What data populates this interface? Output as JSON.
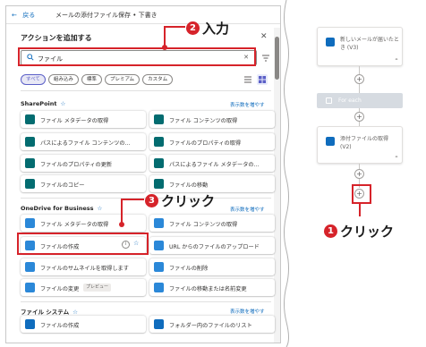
{
  "topbar": {
    "back_label": "戻る",
    "breadcrumb": "メールの添付ファイル保存 • 下書き"
  },
  "panel": {
    "title": "アクションを追加する"
  },
  "search": {
    "value": "ファイル"
  },
  "chips": [
    "すべて",
    "組み込み",
    "標準",
    "プレミアム",
    "カスタム"
  ],
  "sections": [
    {
      "name": "SharePoint",
      "see_more": "表示数を増やす",
      "actions": [
        "ファイル メタデータの取得",
        "ファイル コンテンツの取得",
        "パスによるファイル コンテンツの...",
        "ファイルのプロパティの取得",
        "ファイルのプロパティの更新",
        "パスによるファイル メタデータの...",
        "ファイルのコピー",
        "ファイルの移動"
      ]
    },
    {
      "name": "OneDrive for Business",
      "see_more": "表示数を増やす",
      "actions": [
        "ファイル メタデータの取得",
        "ファイル コンテンツの取得",
        "ファイルの作成",
        "URL からのファイルのアップロード",
        "ファイルのサムネイルを取得します",
        "ファイルの削除",
        "ファイルの変更",
        "ファイルの移動または名前変更"
      ],
      "preview_tag": "プレビュー"
    },
    {
      "name": "ファイル システム",
      "see_more": "表示数を増やす",
      "actions": [
        "ファイルの作成",
        "フォルダー内のファイルのリスト"
      ]
    }
  ],
  "flow": {
    "trigger_title": "新しいメールが届いたとき (V3)",
    "foreach_label": "For each",
    "attach_title": "添付ファイルの取得 (V2)"
  },
  "annotations": {
    "step1_num": "1",
    "step1_text": "クリック",
    "step2_num": "2",
    "step2_text": "入力",
    "step3_num": "3",
    "step3_text": "クリック"
  },
  "colors": {
    "annotation_red": "#d6232a",
    "accent_blue": "#0f6cbd",
    "sharepoint_teal": "#036c70",
    "onedrive_blue": "#2b88d8"
  }
}
